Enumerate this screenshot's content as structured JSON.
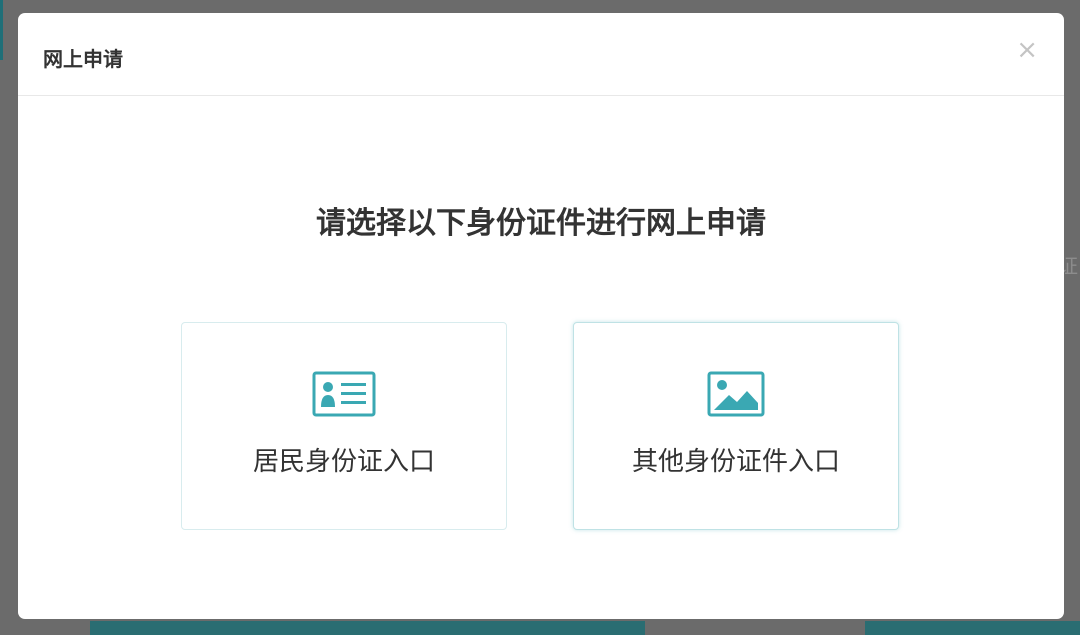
{
  "dialog": {
    "title": "网上申请",
    "close_glyph": "×",
    "prompt": "请选择以下身份证件进行网上申请"
  },
  "options": [
    {
      "label": "居民身份证入口",
      "icon": "id-card-icon"
    },
    {
      "label": "其他身份证件入口",
      "icon": "image-icon"
    }
  ],
  "background_peek_text": "证",
  "colors": {
    "accent": "#3aa8b3",
    "title_text": "#333333",
    "backdrop": "#6b6b6b"
  }
}
